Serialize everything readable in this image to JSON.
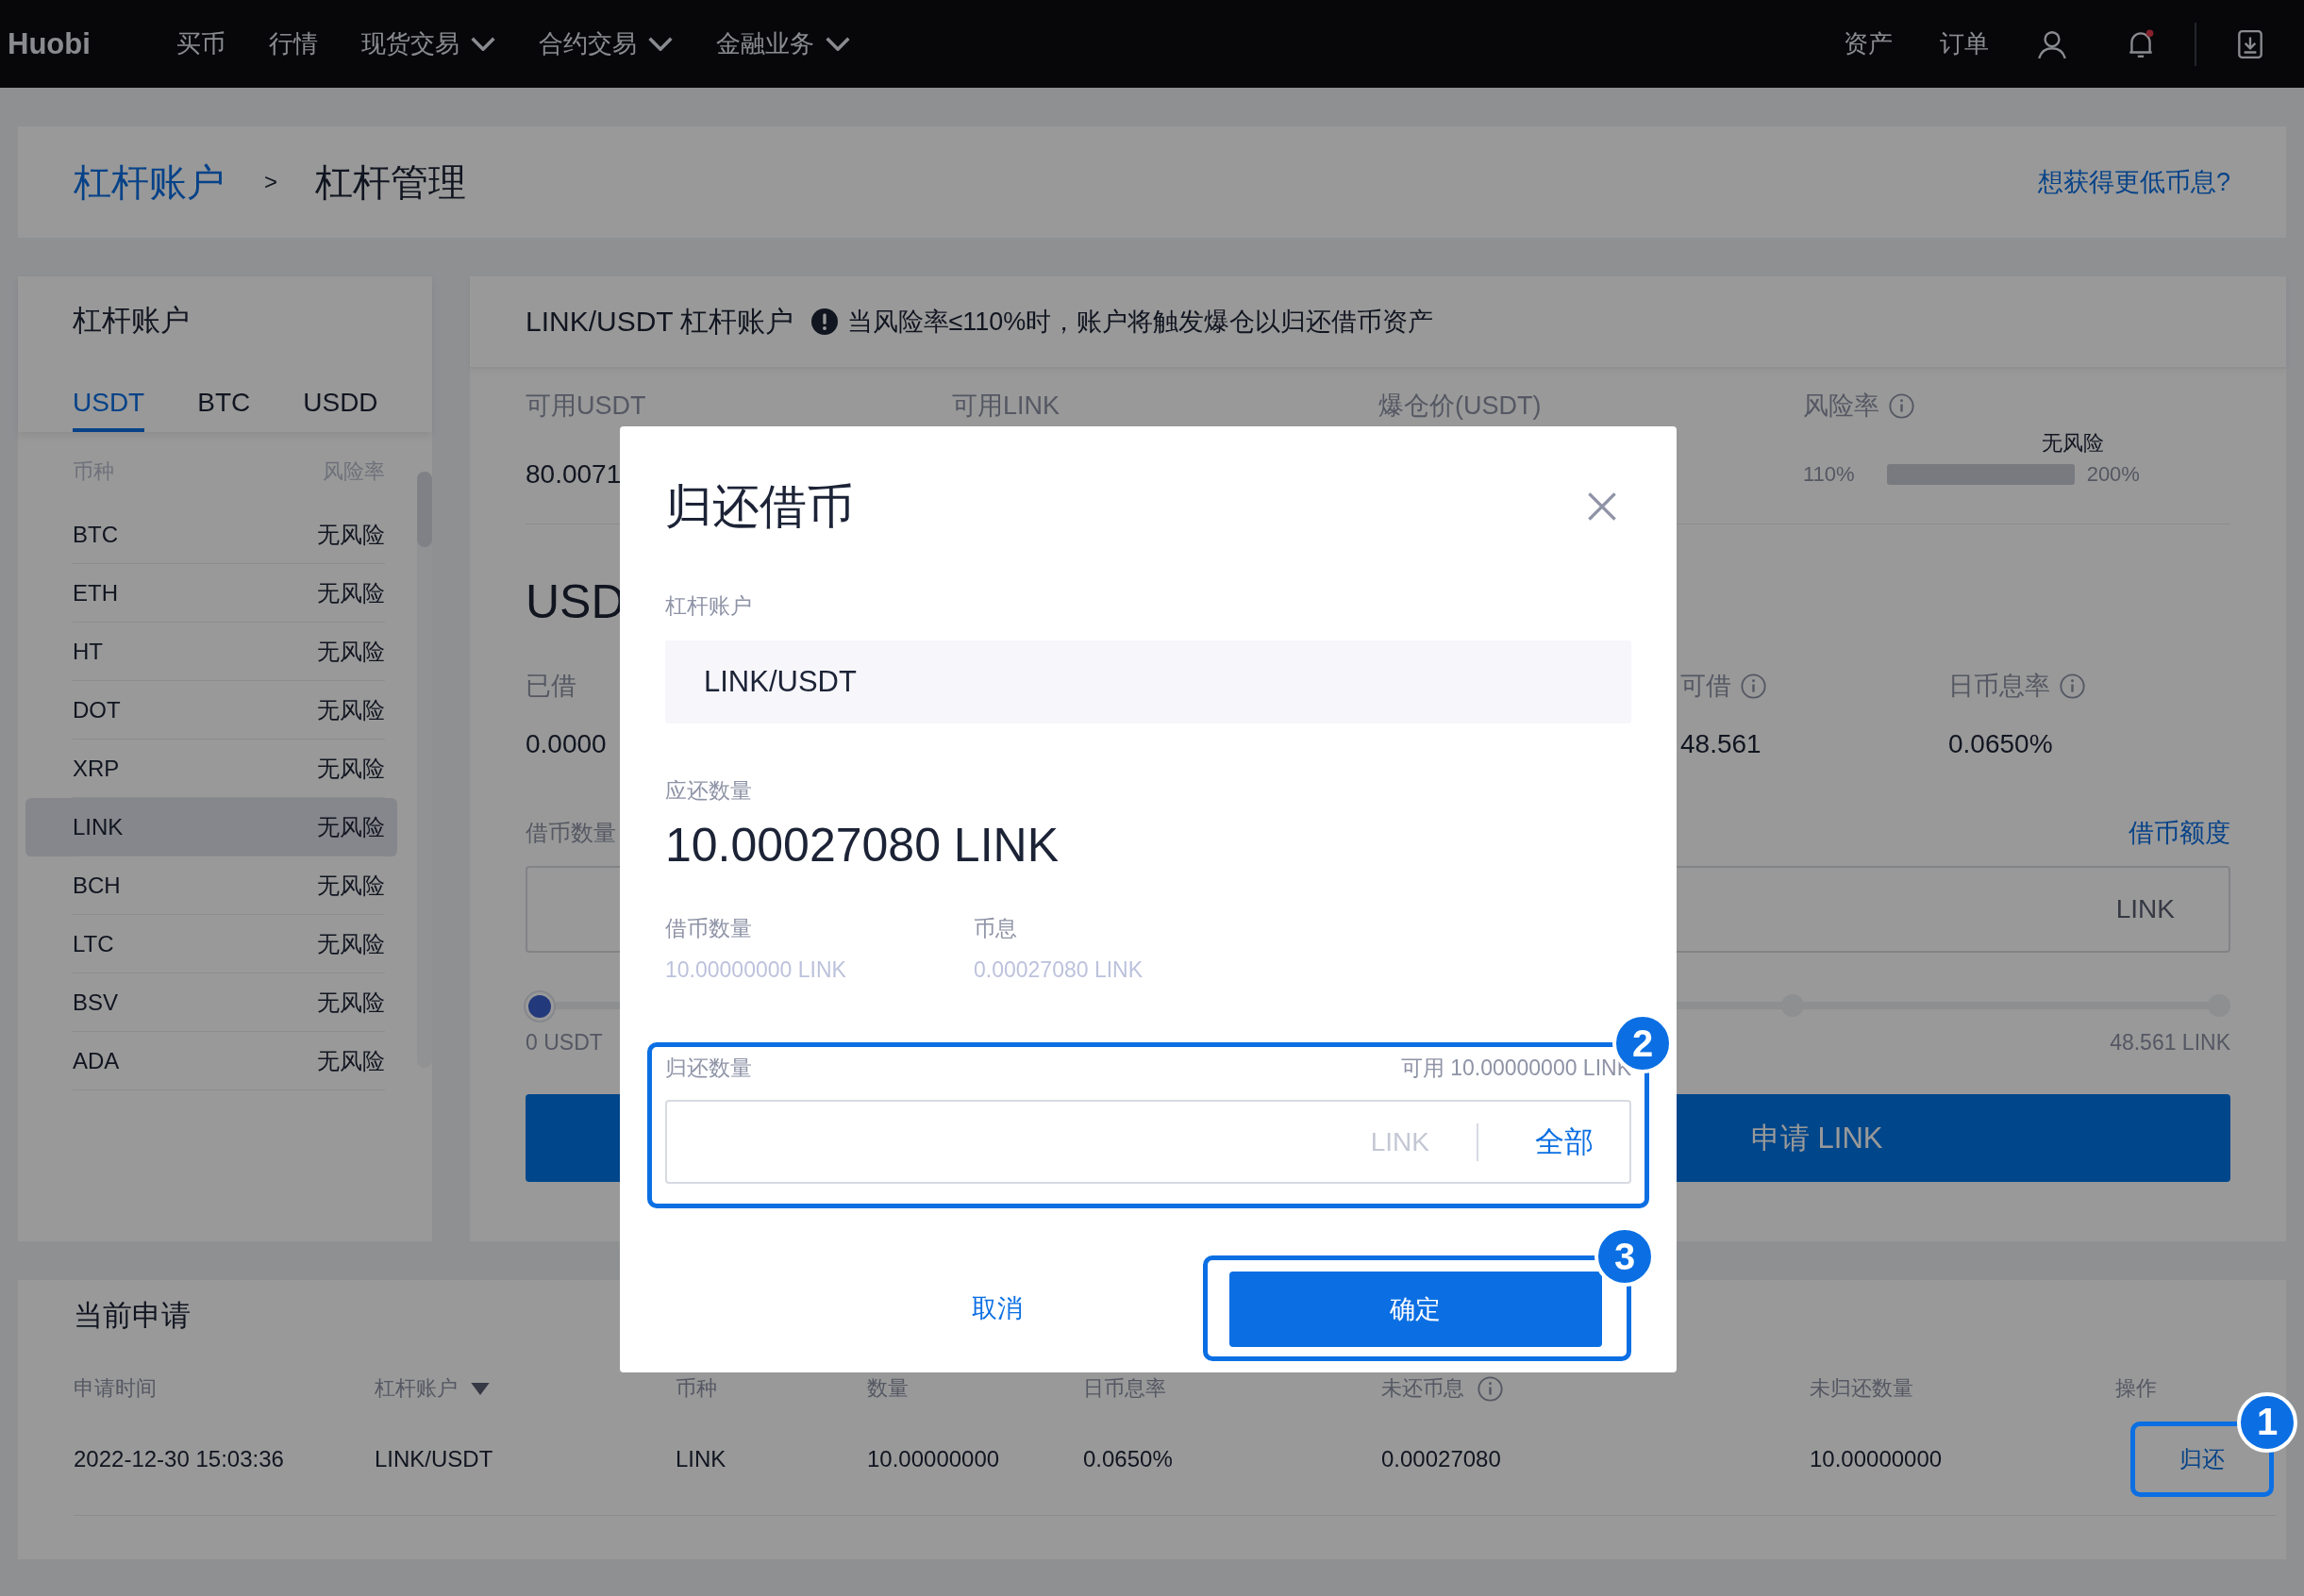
{
  "nav": {
    "logo": "Huobi",
    "items": [
      {
        "label": "买币",
        "has_menu": false
      },
      {
        "label": "行情",
        "has_menu": false
      },
      {
        "label": "现货交易",
        "has_menu": true
      },
      {
        "label": "合约交易",
        "has_menu": true
      },
      {
        "label": "金融业务",
        "has_menu": true
      }
    ],
    "right_items": [
      "资产",
      "订单"
    ]
  },
  "breadcrumb": {
    "items": [
      {
        "label": "杠杆账户",
        "kind": "link"
      },
      {
        "label": "杠杆管理",
        "kind": "current"
      }
    ],
    "separator": ">",
    "link": "想获得更低币息?"
  },
  "sidebar": {
    "title": "杠杆账户",
    "tabs": [
      {
        "label": "USDT",
        "selected": true
      },
      {
        "label": "BTC",
        "selected": false
      },
      {
        "label": "USDD",
        "selected": false
      }
    ],
    "columns": [
      "币种",
      "风险率"
    ],
    "items": [
      {
        "coin": "BTC",
        "risk": "无风险",
        "selected": false
      },
      {
        "coin": "ETH",
        "risk": "无风险",
        "selected": false
      },
      {
        "coin": "HT",
        "risk": "无风险",
        "selected": false
      },
      {
        "coin": "DOT",
        "risk": "无风险",
        "selected": false
      },
      {
        "coin": "XRP",
        "risk": "无风险",
        "selected": false
      },
      {
        "coin": "LINK",
        "risk": "无风险",
        "selected": true
      },
      {
        "coin": "BCH",
        "risk": "无风险",
        "selected": false
      },
      {
        "coin": "LTC",
        "risk": "无风险",
        "selected": false
      },
      {
        "coin": "BSV",
        "risk": "无风险",
        "selected": false
      },
      {
        "coin": "ADA",
        "risk": "无风险",
        "selected": false
      }
    ]
  },
  "account": {
    "title": "LINK/USDT 杠杆账户",
    "warning": "当风险率≤110%时，账户将触发爆仓以归还借币资产",
    "stats": [
      {
        "label": "可用USDT",
        "value": "80.0071"
      },
      {
        "label": "可用LINK"
      },
      {
        "label": "爆仓价(USDT)"
      }
    ],
    "risk": {
      "label": "风险率",
      "status": "无风险",
      "min": "110%",
      "max": "200%"
    },
    "section_heading": "USD",
    "rates": [
      {
        "label": "已借",
        "value": "0.0000",
        "info": false
      },
      {
        "label": "可借",
        "value": "48.561",
        "info": true
      },
      {
        "label": "日币息率",
        "value": "0.0650%",
        "info": true
      }
    ],
    "amount_label": "借币数量",
    "quota_link": "借币额度",
    "amount_unit": "LINK",
    "slider": {
      "level": 0,
      "min_label": "0 USDT",
      "max_label": "48.561 LINK"
    },
    "submit": "申请 LINK"
  },
  "applications": {
    "title": "当前申请",
    "columns": [
      {
        "label": "申请时间",
        "sortable": false,
        "info": false
      },
      {
        "label": "杠杆账户",
        "sortable": true,
        "info": false
      },
      {
        "label": "币种",
        "sortable": false,
        "info": false
      },
      {
        "label": "数量",
        "sortable": false,
        "info": false
      },
      {
        "label": "日币息率",
        "sortable": false,
        "info": false
      },
      {
        "label": "未还币息",
        "sortable": false,
        "info": true
      },
      {
        "label": "未归还数量",
        "sortable": false,
        "info": false
      },
      {
        "label": "操作",
        "sortable": false,
        "info": false
      }
    ],
    "rows": [
      {
        "cells": [
          "2022-12-30 15:03:36",
          "LINK/USDT",
          "LINK",
          "10.00000000",
          "0.0650%",
          "0.00027080",
          "10.00000000"
        ],
        "action": "归还"
      }
    ]
  },
  "modal": {
    "title": "归还借币",
    "account_label": "杠杆账户",
    "account_value": "LINK/USDT",
    "due_label": "应还数量",
    "due_value": "10.00027080 LINK",
    "details": [
      {
        "label": "借币数量",
        "value": "10.00000000 LINK"
      },
      {
        "label": "币息",
        "value": "0.00027080 LINK"
      }
    ],
    "repay_label": "归还数量",
    "available": "可用 10.00000000 LINK",
    "unit": "LINK",
    "all_button": "全部",
    "cancel": "取消",
    "confirm": "确定"
  },
  "annotations": [
    {
      "number": "1"
    },
    {
      "number": "2"
    },
    {
      "number": "3"
    }
  ]
}
